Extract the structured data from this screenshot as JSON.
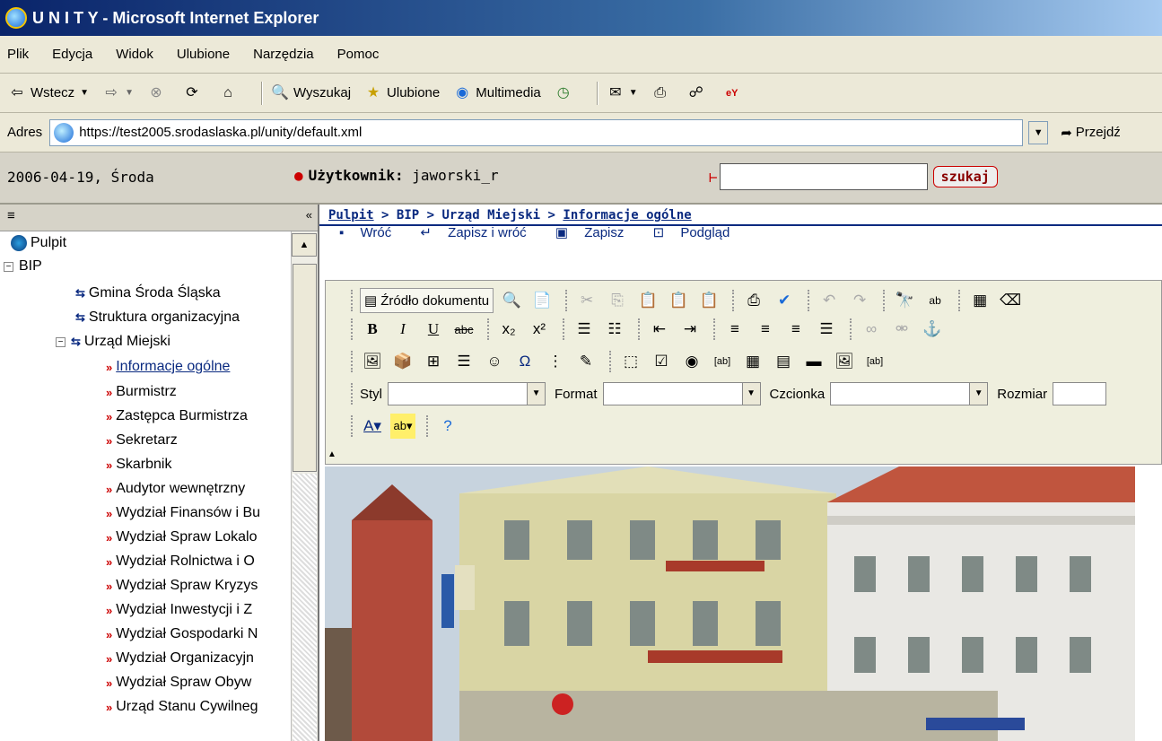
{
  "window": {
    "title": "U N I T Y - Microsoft Internet Explorer"
  },
  "menu": [
    "Plik",
    "Edycja",
    "Widok",
    "Ulubione",
    "Narzędzia",
    "Pomoc"
  ],
  "toolbar": {
    "back": "Wstecz",
    "search": "Wyszukaj",
    "favorites": "Ulubione",
    "media": "Multimedia"
  },
  "address": {
    "label": "Adres",
    "url": "https://test2005.srodaslaska.pl/unity/default.xml",
    "go": "Przejdź"
  },
  "appbar": {
    "date": "2006-04-19, Środa",
    "user_label": "Użytkownik:",
    "user": "jaworski_r",
    "search_btn": "szukaj"
  },
  "sidebar": {
    "collapse_symbol": "≡",
    "hide_symbol": "«"
  },
  "tree": [
    "Pulpit",
    "BIP",
    "Gmina Środa Śląska",
    "Struktura organizacyjna",
    "Urząd Miejski",
    "Informacje ogólne",
    "Burmistrz",
    "Zastępca Burmistrza",
    "Sekretarz",
    "Skarbnik",
    "Audytor wewnętrzny",
    "Wydział Finansów i Bu",
    "Wydział Spraw Lokalo",
    "Wydział Rolnictwa i O",
    "Wydział Spraw Kryzys",
    "Wydział Inwestycji i Z",
    "Wydział Gospodarki N",
    "Wydział Organizacyjn",
    "Wydział Spraw Obyw",
    "Urząd Stanu Cywilneg"
  ],
  "breadcrumb": {
    "items": [
      "Pulpit",
      "BIP",
      "Urząd Miejski",
      "Informacje ogólne"
    ],
    "sep": ">"
  },
  "actions": {
    "back": "Wróć",
    "save_back": "Zapisz i wróć",
    "save": "Zapisz",
    "preview": "Podgląd"
  },
  "editor": {
    "source": "Źródło dokumentu",
    "style_label": "Styl",
    "format_label": "Format",
    "font_label": "Czcionka",
    "size_label": "Rozmiar"
  }
}
